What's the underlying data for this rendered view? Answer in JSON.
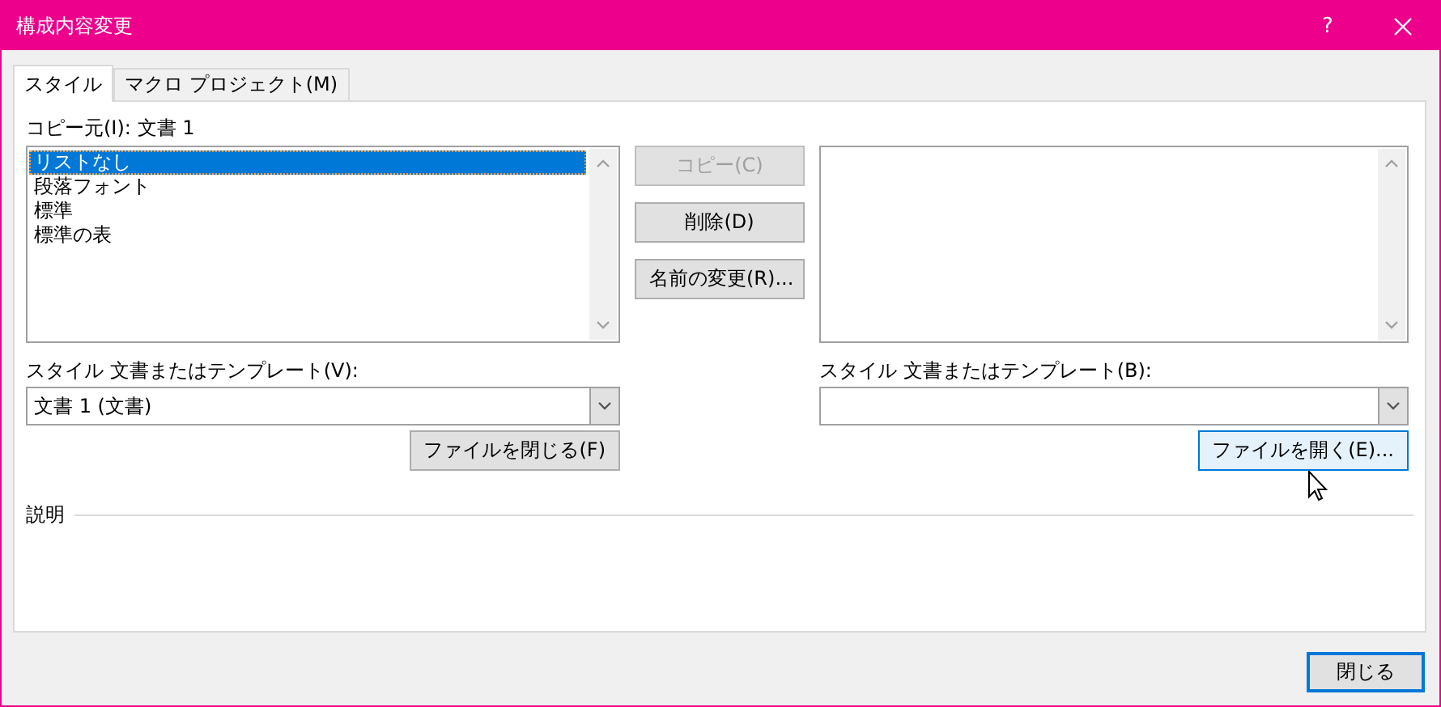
{
  "window": {
    "title": "構成内容変更",
    "help_button": "?"
  },
  "tabs": [
    {
      "label": "スタイル",
      "selected": true
    },
    {
      "label": "マクロ プロジェクト(M)",
      "selected": false
    }
  ],
  "left": {
    "label": "コピー元(I): 文書 1",
    "items": [
      {
        "label": "リストなし",
        "selected": true
      },
      {
        "label": "段落フォント",
        "selected": false
      },
      {
        "label": "標準",
        "selected": false
      },
      {
        "label": "標準の表",
        "selected": false
      }
    ],
    "source_label": "スタイル 文書またはテンプレート(V):",
    "source_value": "文書 1 (文書)",
    "file_button": {
      "label": "ファイルを閉じる(F)",
      "hovered": false
    }
  },
  "actions": [
    {
      "label": "コピー(C)",
      "disabled": true
    },
    {
      "label": "削除(D)",
      "disabled": false
    },
    {
      "label": "名前の変更(R)...",
      "disabled": false
    }
  ],
  "right": {
    "source_label": "スタイル 文書またはテンプレート(B):",
    "file_button": {
      "label": "ファイルを開く(E)...",
      "hovered": true
    }
  },
  "description": {
    "label": "説明"
  },
  "close_button": {
    "label": "閉じる",
    "default": true
  }
}
